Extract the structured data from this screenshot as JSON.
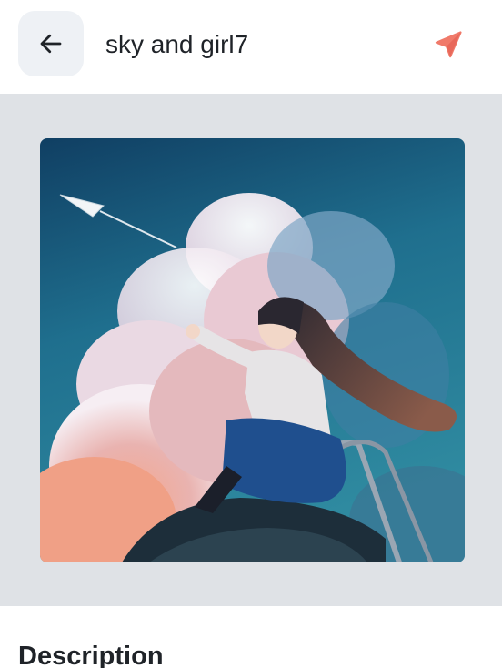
{
  "header": {
    "title": "sky and girl7",
    "back_icon": "arrow-left-icon",
    "send_icon": "send-icon",
    "accent_color": "#f07a6a"
  },
  "image": {
    "icon": "artwork-image"
  },
  "description": {
    "heading": "Description"
  }
}
